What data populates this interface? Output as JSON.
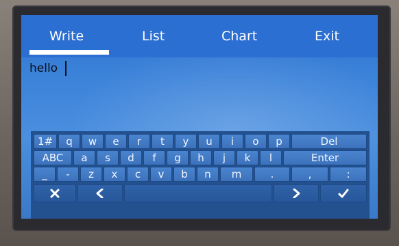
{
  "tabs": [
    {
      "label": "Write",
      "active": true
    },
    {
      "label": "List",
      "active": false
    },
    {
      "label": "Chart",
      "active": false
    },
    {
      "label": "Exit",
      "active": false
    }
  ],
  "editor": {
    "value": "hello"
  },
  "keyboard": {
    "rows": [
      [
        "1#",
        "q",
        "w",
        "e",
        "r",
        "t",
        "y",
        "u",
        "i",
        "o",
        "p",
        "Del"
      ],
      [
        "ABC",
        "a",
        "s",
        "d",
        "f",
        "g",
        "h",
        "j",
        "k",
        "l",
        "Enter"
      ],
      [
        "_",
        "-",
        "z",
        "x",
        "c",
        "v",
        "b",
        "n",
        "m",
        ".",
        ",",
        ":"
      ]
    ],
    "bottom_icons": [
      "close-icon",
      "arrow-left-icon",
      "space-key",
      "arrow-right-icon",
      "check-icon"
    ]
  },
  "colors": {
    "tab_bar": "#2c6fd2",
    "keyboard_bg": "#23508f",
    "key": "#3c72bb",
    "text": "#ffffff"
  }
}
